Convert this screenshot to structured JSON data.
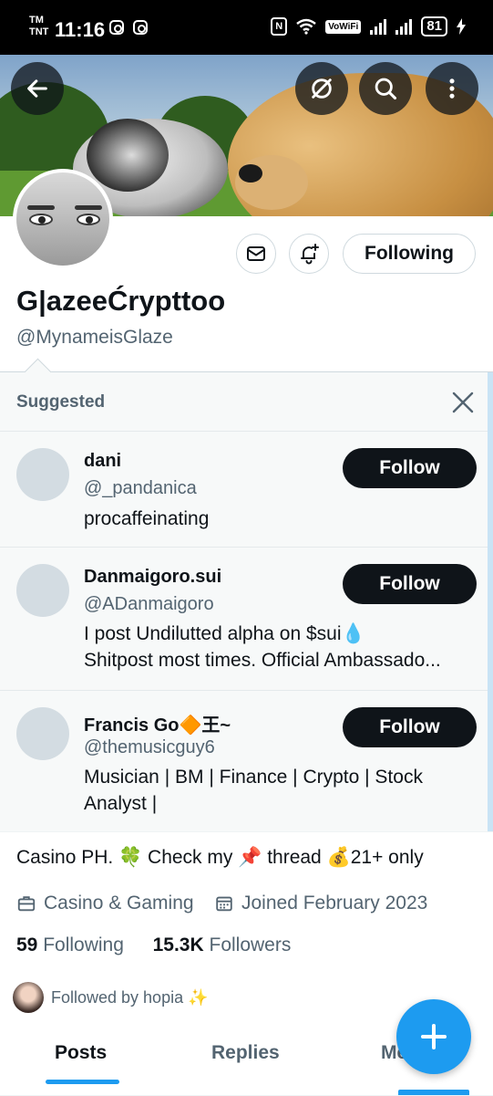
{
  "status_bar": {
    "carrier_top": "TM",
    "carrier_bottom": "TNT",
    "time": "11:16",
    "vowifi": "VoWiFi",
    "battery": "81"
  },
  "header": {
    "back_icon": "back-arrow-icon",
    "grok_icon": "slashed-circle-icon",
    "search_icon": "search-icon",
    "more_icon": "more-vertical-icon"
  },
  "profile": {
    "display_name": "G|azeeĆrypttoo",
    "handle": "@MynameisGlaze",
    "following_button": "Following",
    "bio": "Casino PH. 🍀 Check my 📌 thread 💰21+ only",
    "category": "Casino & Gaming",
    "joined": "Joined February 2023",
    "following_count": "59",
    "following_label": "Following",
    "followers_count": "15.3K",
    "followers_label": "Followers",
    "followed_by": "Followed by hopia ✨"
  },
  "suggested": {
    "title": "Suggested",
    "follow_label": "Follow",
    "accounts": [
      {
        "name": "dani",
        "handle": "@_pandanica",
        "bio_line1": "procaffeinating",
        "bio_line2": ""
      },
      {
        "name": "Danmaigoro.sui",
        "handle": "@ADanmaigoro",
        "bio_line1": "I post Undilutted alpha on $sui💧",
        "bio_line2": "Shitpost most times. Official Ambassado..."
      },
      {
        "name": "Francis Go🔶王~",
        "handle": "@themusicguy6",
        "bio_line1": "Musician | BM | Finance | Crypto | Stock",
        "bio_line2": "Analyst |"
      }
    ]
  },
  "tabs": {
    "posts": "Posts",
    "replies": "Replies",
    "more": "Media"
  },
  "colors": {
    "accent": "#1d9bf0",
    "text": "#0f1419",
    "secondary": "#536471",
    "panel": "#f7f9f9"
  }
}
